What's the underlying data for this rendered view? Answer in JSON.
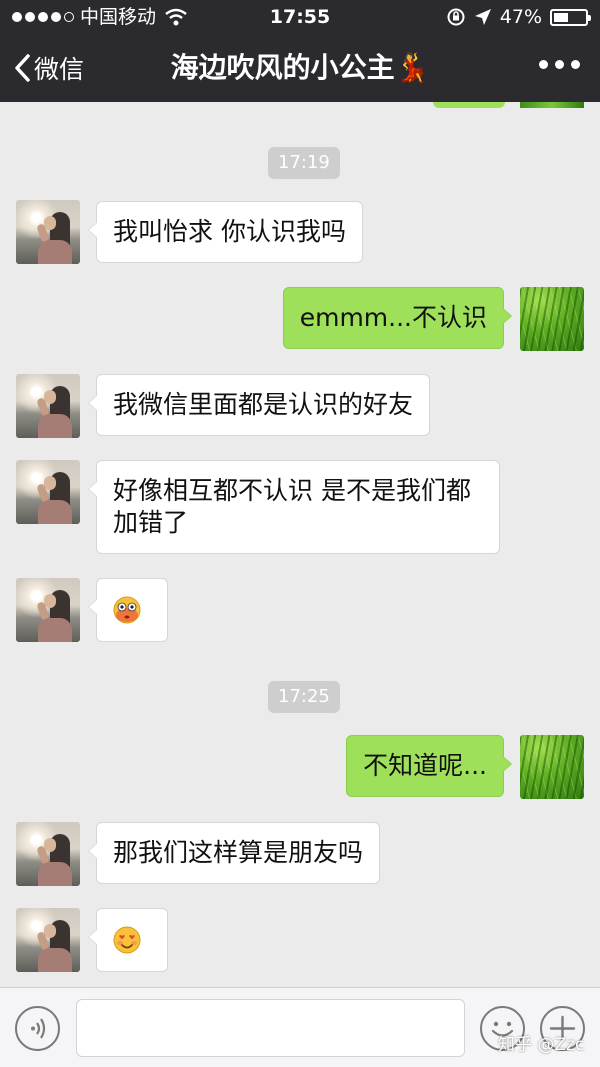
{
  "status_bar": {
    "carrier": "中国移动",
    "time": "17:55",
    "battery": "47%",
    "battery_level": 0.47
  },
  "nav": {
    "back_label": "微信",
    "title": "海边吹风的小公主💃"
  },
  "timestamps": [
    "17:19",
    "17:25"
  ],
  "messages": [
    {
      "side": "in",
      "text": "我叫怡求 你认识我吗"
    },
    {
      "side": "out",
      "text": "emmm...不认识"
    },
    {
      "side": "in",
      "text": "我微信里面都是认识的好友"
    },
    {
      "side": "in",
      "line1": "好像相互都不认识 是不是我们都",
      "line2": "加错了"
    },
    {
      "side": "in",
      "emoji": "flushed-face-icon"
    },
    {
      "side": "out",
      "text": "不知道呢..."
    },
    {
      "side": "in",
      "text": "那我们这样算是朋友吗"
    },
    {
      "side": "in",
      "emoji": "smiling-heart-eyes-icon"
    }
  ],
  "watermark": "知乎 @Zzc",
  "colors": {
    "nav_bg": "#2b2b2f",
    "chat_bg": "#ebebeb",
    "outgoing_bubble": "#9ee05a",
    "incoming_bubble": "#ffffff"
  }
}
